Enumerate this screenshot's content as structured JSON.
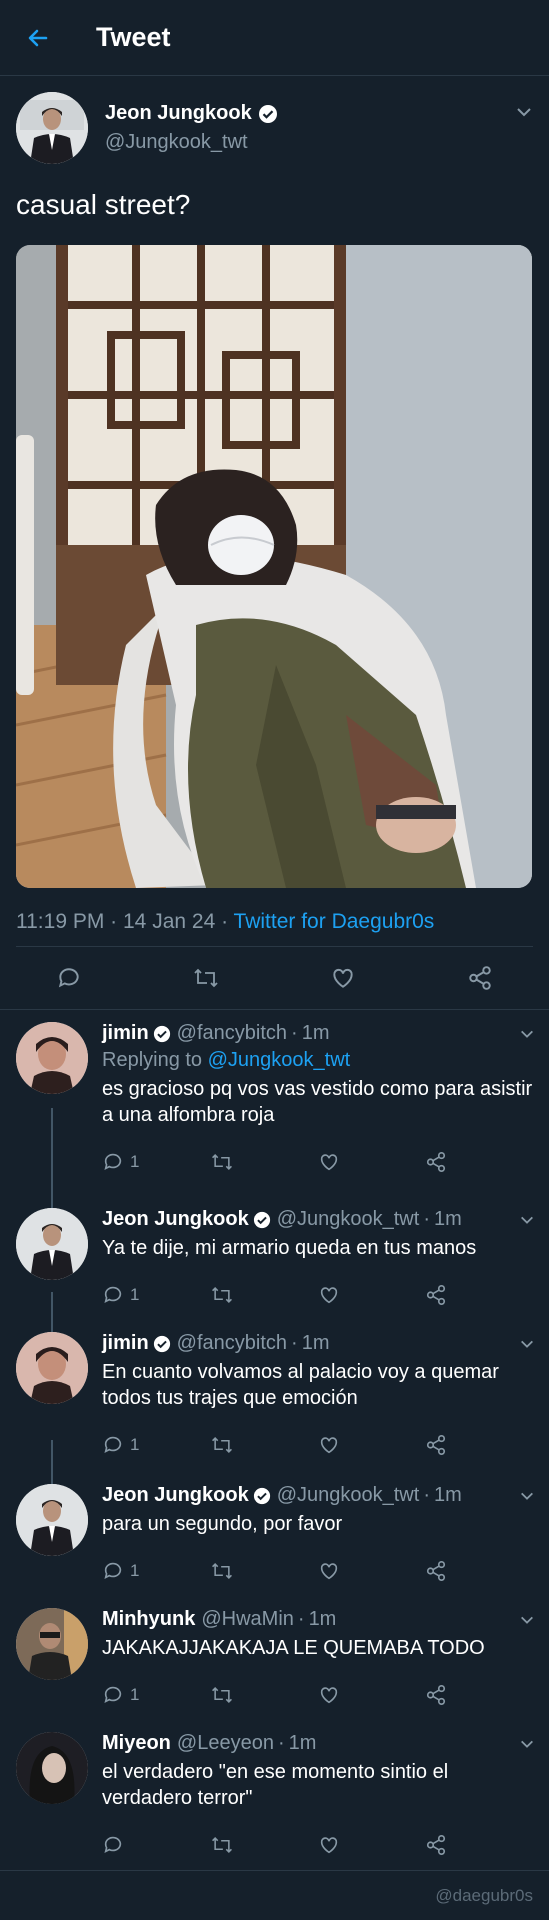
{
  "header": {
    "title": "Tweet"
  },
  "tweet": {
    "author_name": "Jeon Jungkook",
    "author_handle": "@Jungkook_twt",
    "text": "casual street?",
    "time": "11:19 PM",
    "date": "14 Jan 24",
    "source": "Twitter for Daegubr0s"
  },
  "colors": {
    "background": "#15202b",
    "accent": "#1da1f2",
    "muted": "#8899a6",
    "divider": "#2a3845"
  },
  "icons": [
    "back-arrow-icon",
    "verified-badge-icon",
    "chevron-down-icon",
    "reply-icon",
    "retweet-icon",
    "like-icon",
    "share-icon"
  ],
  "replies": [
    {
      "name": "jimin",
      "verified": true,
      "handle": "@fancybitch",
      "time": "1m",
      "replying_label": "Replying to",
      "replying_to": "@Jungkook_twt",
      "text": "es gracioso pq vos vas vestido como para asistir a una alfombra roja",
      "reply_count": "1"
    },
    {
      "name": "Jeon Jungkook",
      "verified": true,
      "handle": "@Jungkook_twt",
      "time": "1m",
      "text": "Ya te dije, mi armario queda en tus manos",
      "reply_count": "1"
    },
    {
      "name": "jimin",
      "verified": true,
      "handle": "@fancybitch",
      "time": "1m",
      "text": "En cuanto volvamos al palacio voy a quemar todos tus trajes que emoción",
      "reply_count": "1"
    },
    {
      "name": "Jeon Jungkook",
      "verified": true,
      "handle": "@Jungkook_twt",
      "time": "1m",
      "text": "para un segundo, por favor",
      "reply_count": "1"
    },
    {
      "name": "Minhyunk",
      "verified": false,
      "handle": "@HwaMin",
      "time": "1m",
      "text": "JAKAKAJJAKAKAJA LE QUEMABA TODO",
      "reply_count": "1"
    },
    {
      "name": "Miyeon",
      "verified": false,
      "handle": "@Leeyeon",
      "time": "1m",
      "text": "el verdadero \"en ese momento sintio el verdadero terror\"",
      "reply_count": ""
    }
  ],
  "watermark": "@daegubr0s"
}
